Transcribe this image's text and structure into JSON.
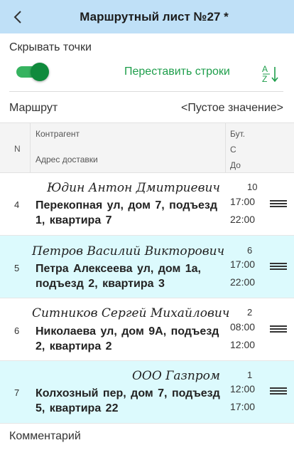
{
  "header": {
    "title": "Маршрутный лист №27 *",
    "back_icon": "chevron-left-icon"
  },
  "controls": {
    "hide_points_label": "Скрывать точки",
    "hide_points_on": true,
    "rearrange_label": "Переставить строки",
    "sort_icon": "sort-alpha-az-icon",
    "sort_icon_a": "А",
    "sort_icon_z": "Z",
    "accent_color": "#1e9e4b"
  },
  "route": {
    "label": "Маршрут",
    "value": "<Пустое значение>"
  },
  "table": {
    "columns": {
      "n": "N",
      "counterparty": "Контрагент",
      "address": "Адрес доставки",
      "qty": "Бут.",
      "from": "С",
      "to": "До"
    },
    "rows": [
      {
        "n": "4",
        "name": "Юдин Антон Дмитриевич",
        "address": "Перекопная ул,  дом 7,  подъезд 1,  квартира 7",
        "qty": "10",
        "from": "17:00",
        "to": "22:00"
      },
      {
        "n": "5",
        "name": "Петров Василий Викторович",
        "address": "Петра Алексеева ул,  дом 1а, подъезд 2,  квартира 3",
        "qty": "6",
        "from": "17:00",
        "to": "22:00"
      },
      {
        "n": "6",
        "name": "Ситников Сергей Михайлович",
        "address": "Николаева ул,  дом 9А, подъезд 2,  квартира 2",
        "qty": "2",
        "from": "08:00",
        "to": "12:00"
      },
      {
        "n": "7",
        "name": "ООО Газпром",
        "address": "Колхозный пер,  дом 7, подъезд 5,  квартира 22",
        "qty": "1",
        "from": "12:00",
        "to": "17:00"
      }
    ]
  },
  "comment": {
    "label": "Комментарий"
  }
}
